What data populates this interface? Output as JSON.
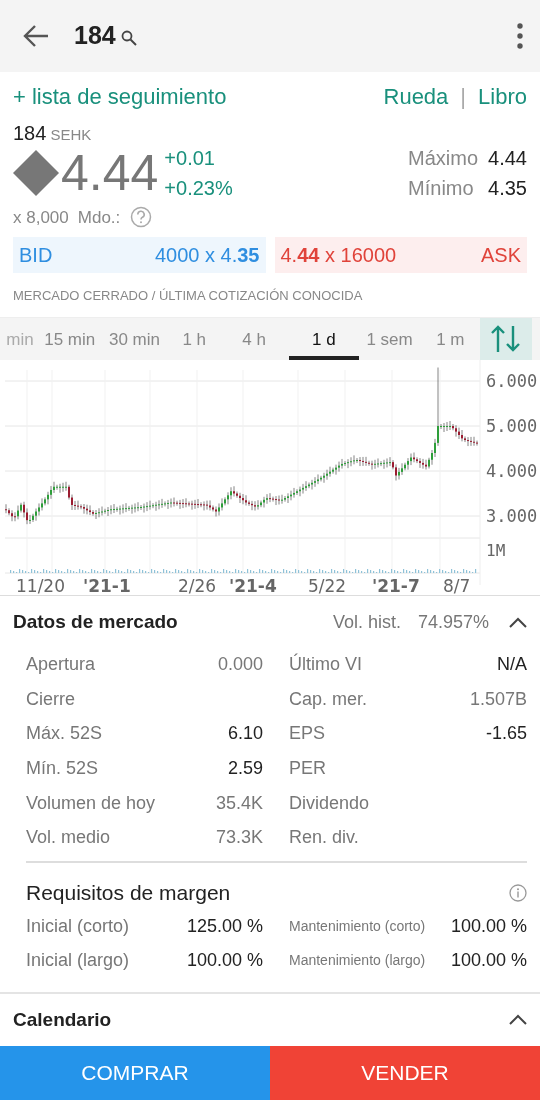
{
  "header": {
    "title": "184"
  },
  "links": {
    "watchlist": "+ lista de seguimiento",
    "wheel": "Rueda",
    "separator": "|",
    "book": "Libro"
  },
  "quote": {
    "symbol": "184",
    "exchange": "SEHK",
    "price": "4.44",
    "change": "+0.01",
    "change_pct": "+0.23%",
    "high_label": "Máximo",
    "high": "4.44",
    "low_label": "Mínimo",
    "low": "4.35",
    "size": "x 8,000",
    "market_label": "Mdo.:"
  },
  "bid": {
    "label": "BID",
    "value": "4000 x 4.**35**"
  },
  "ask": {
    "value": "4.**44** x 16000",
    "label": "ASK"
  },
  "market_status": "MERCADO CERRADO / ÚLTIMA COTIZACIÓN CONOCIDA",
  "tabs": [
    {
      "label": "min",
      "selected": false,
      "cut": true
    },
    {
      "label": "15 min",
      "selected": false,
      "cut": false
    },
    {
      "label": "30 min",
      "selected": false,
      "cut": false
    },
    {
      "label": "1 h",
      "selected": false,
      "cut": false
    },
    {
      "label": "4 h",
      "selected": false,
      "cut": false
    },
    {
      "label": "1 d",
      "selected": true,
      "cut": false
    },
    {
      "label": "1 sem",
      "selected": false,
      "cut": false
    },
    {
      "label": "1 m",
      "selected": false,
      "cut": false
    }
  ],
  "chart": {
    "y_labels": [
      "6.000",
      "5.000",
      "4.000",
      "3.000"
    ],
    "volume_label": "1M",
    "x_labels": [
      {
        "text": "11/20",
        "strong": false
      },
      {
        "text": "'21-1",
        "strong": true
      },
      {
        "text": "2/26",
        "strong": false
      },
      {
        "text": "'21-4",
        "strong": true
      },
      {
        "text": "5/22",
        "strong": false
      },
      {
        "text": "'21-7",
        "strong": true
      },
      {
        "text": "8/7",
        "strong": false
      }
    ]
  },
  "market_data": {
    "title": "Datos de mercado",
    "hist_vol_label": "Vol. hist.",
    "hist_vol": "74.957%",
    "rows": [
      {
        "left_label": "Apertura",
        "left_value": "0.000",
        "left_dark": false,
        "right_label": "Último VI",
        "right_value": "N/A",
        "right_dark": true
      },
      {
        "left_label": "Cierre",
        "right_label": "Cap. mer.",
        "right_value": "1.507B",
        "right_dark": false
      },
      {
        "left_label": "Máx. 52S",
        "left_value": "6.10",
        "left_dark": true,
        "right_label": "EPS",
        "right_value": "-1.65",
        "right_dark": true
      },
      {
        "left_label": "Mín. 52S",
        "left_value": "2.59",
        "left_dark": true,
        "right_label": "PER"
      },
      {
        "left_label": "Volumen de hoy",
        "left_value": "35.4K",
        "left_dark": false,
        "right_label": "Dividendo"
      },
      {
        "left_label": "Vol. medio",
        "left_value": "73.3K",
        "left_dark": false,
        "right_label": "Ren. div."
      }
    ]
  },
  "margin": {
    "title": "Requisitos de margen",
    "rows": [
      {
        "left_label": "Inicial (corto)",
        "left_value": "125.00 %",
        "right_label": "Mantenimiento (corto)",
        "right_value": "100.00 %"
      },
      {
        "left_label": "Inicial (largo)",
        "left_value": "100.00 %",
        "right_label": "Mantenimiento (largo)",
        "right_value": "100.00 %"
      }
    ]
  },
  "calendar": {
    "title": "Calendario"
  },
  "buttons": {
    "buy": "COMPRAR",
    "sell": "VENDER"
  }
}
